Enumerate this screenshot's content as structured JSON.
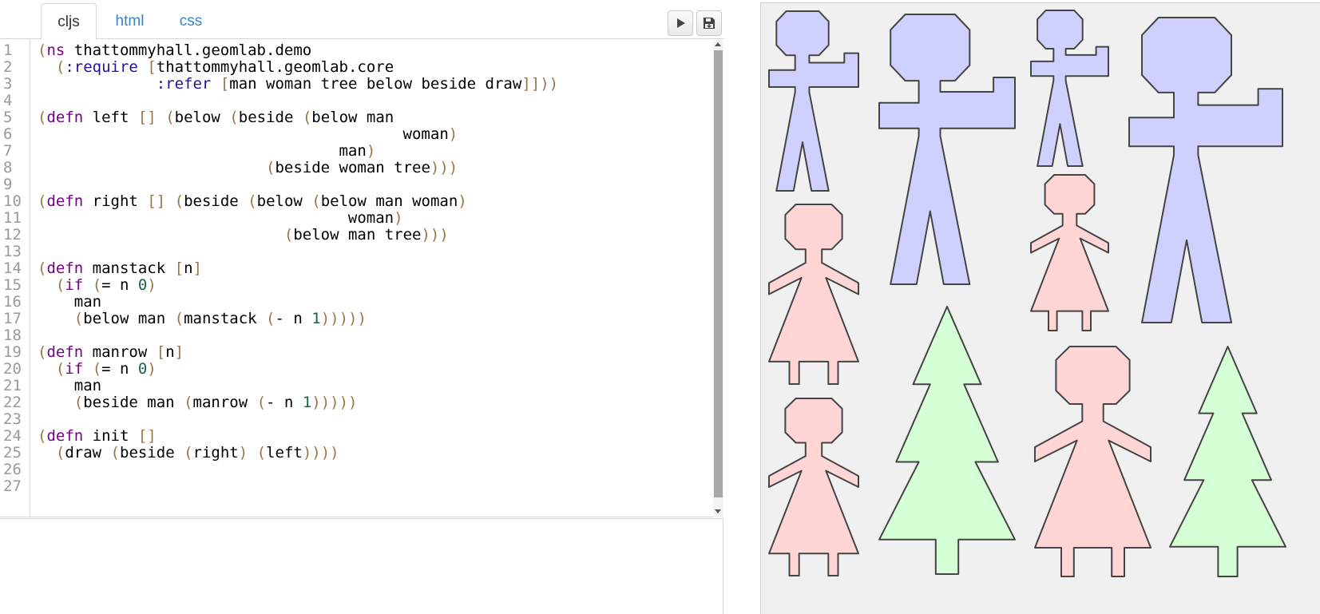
{
  "tabs": [
    {
      "label": "cljs",
      "active": true
    },
    {
      "label": "html",
      "active": false
    },
    {
      "label": "css",
      "active": false
    }
  ],
  "toolbar": {
    "run_icon": "play-icon",
    "save_icon": "save-icon"
  },
  "editor": {
    "line_numbers": [
      "1",
      "2",
      "3",
      "4",
      "5",
      "6",
      "7",
      "8",
      "9",
      "10",
      "11",
      "12",
      "13",
      "14",
      "15",
      "16",
      "17",
      "18",
      "19",
      "20",
      "21",
      "22",
      "23",
      "24",
      "25",
      "26",
      "27"
    ],
    "lines": [
      [
        [
          "br",
          "("
        ],
        [
          "kw",
          "ns"
        ],
        [
          "t",
          " thattommyhall.geomlab.demo"
        ]
      ],
      [
        [
          "t",
          "  "
        ],
        [
          "br",
          "("
        ],
        [
          "atom",
          ":require"
        ],
        [
          "t",
          " "
        ],
        [
          "br",
          "["
        ],
        [
          "t",
          "thattommyhall.geomlab.core"
        ]
      ],
      [
        [
          "t",
          "             "
        ],
        [
          "atom",
          ":refer"
        ],
        [
          "t",
          " "
        ],
        [
          "br",
          "["
        ],
        [
          "t",
          "man woman tree below beside draw"
        ],
        [
          "br",
          "]]))"
        ]
      ],
      [],
      [
        [
          "br",
          "("
        ],
        [
          "kw",
          "defn"
        ],
        [
          "t",
          " left "
        ],
        [
          "br",
          "[]"
        ],
        [
          "t",
          " "
        ],
        [
          "br",
          "("
        ],
        [
          "t",
          "below "
        ],
        [
          "br",
          "("
        ],
        [
          "t",
          "beside "
        ],
        [
          "br",
          "("
        ],
        [
          "t",
          "below man"
        ]
      ],
      [
        [
          "t",
          "                                        woman"
        ],
        [
          "br",
          ")"
        ]
      ],
      [
        [
          "t",
          "                                 man"
        ],
        [
          "br",
          ")"
        ]
      ],
      [
        [
          "t",
          "                         "
        ],
        [
          "br",
          "("
        ],
        [
          "t",
          "beside woman tree"
        ],
        [
          "br",
          ")))"
        ]
      ],
      [],
      [
        [
          "br",
          "("
        ],
        [
          "kw",
          "defn"
        ],
        [
          "t",
          " right "
        ],
        [
          "br",
          "[]"
        ],
        [
          "t",
          " "
        ],
        [
          "br",
          "("
        ],
        [
          "t",
          "beside "
        ],
        [
          "br",
          "("
        ],
        [
          "t",
          "below "
        ],
        [
          "br",
          "("
        ],
        [
          "t",
          "below man woman"
        ],
        [
          "br",
          ")"
        ]
      ],
      [
        [
          "t",
          "                                  woman"
        ],
        [
          "br",
          ")"
        ]
      ],
      [
        [
          "t",
          "                           "
        ],
        [
          "br",
          "("
        ],
        [
          "t",
          "below man tree"
        ],
        [
          "br",
          ")))"
        ]
      ],
      [],
      [
        [
          "br",
          "("
        ],
        [
          "kw",
          "defn"
        ],
        [
          "t",
          " manstack "
        ],
        [
          "br",
          "["
        ],
        [
          "t",
          "n"
        ],
        [
          "br",
          "]"
        ]
      ],
      [
        [
          "t",
          "  "
        ],
        [
          "br",
          "("
        ],
        [
          "kw",
          "if"
        ],
        [
          "t",
          " "
        ],
        [
          "br",
          "("
        ],
        [
          "t",
          "= n "
        ],
        [
          "num",
          "0"
        ],
        [
          "br",
          ")"
        ]
      ],
      [
        [
          "t",
          "    man"
        ]
      ],
      [
        [
          "t",
          "    "
        ],
        [
          "br",
          "("
        ],
        [
          "t",
          "below man "
        ],
        [
          "br",
          "("
        ],
        [
          "t",
          "manstack "
        ],
        [
          "br",
          "("
        ],
        [
          "t",
          "- n "
        ],
        [
          "num",
          "1"
        ],
        [
          "br",
          ")))))"
        ]
      ],
      [],
      [
        [
          "br",
          "("
        ],
        [
          "kw",
          "defn"
        ],
        [
          "t",
          " manrow "
        ],
        [
          "br",
          "["
        ],
        [
          "t",
          "n"
        ],
        [
          "br",
          "]"
        ]
      ],
      [
        [
          "t",
          "  "
        ],
        [
          "br",
          "("
        ],
        [
          "kw",
          "if"
        ],
        [
          "t",
          " "
        ],
        [
          "br",
          "("
        ],
        [
          "t",
          "= n "
        ],
        [
          "num",
          "0"
        ],
        [
          "br",
          ")"
        ]
      ],
      [
        [
          "t",
          "    man"
        ]
      ],
      [
        [
          "t",
          "    "
        ],
        [
          "br",
          "("
        ],
        [
          "t",
          "beside man "
        ],
        [
          "br",
          "("
        ],
        [
          "t",
          "manrow "
        ],
        [
          "br",
          "("
        ],
        [
          "t",
          "- n "
        ],
        [
          "num",
          "1"
        ],
        [
          "br",
          ")))))"
        ]
      ],
      [],
      [
        [
          "br",
          "("
        ],
        [
          "kw",
          "defn"
        ],
        [
          "t",
          " init "
        ],
        [
          "br",
          "[]"
        ]
      ],
      [
        [
          "t",
          "  "
        ],
        [
          "br",
          "("
        ],
        [
          "t",
          "draw "
        ],
        [
          "br",
          "("
        ],
        [
          "t",
          "beside "
        ],
        [
          "br",
          "("
        ],
        [
          "t",
          "right"
        ],
        [
          "br",
          ")"
        ],
        [
          "t",
          " "
        ],
        [
          "br",
          "("
        ],
        [
          "t",
          "left"
        ],
        [
          "br",
          "))))"
        ]
      ],
      [],
      []
    ]
  },
  "console": {
    "text": ""
  },
  "drawing": {
    "colors": {
      "man": "#d0d0ff",
      "woman": "#ffd5d5",
      "tree": "#d5ffd5",
      "outline": "#444444",
      "background": "#f0f0f0"
    },
    "figures": [
      {
        "kind": "man",
        "name": "man-figure"
      },
      {
        "kind": "woman",
        "name": "woman-figure"
      },
      {
        "kind": "woman",
        "name": "woman-figure"
      },
      {
        "kind": "man",
        "name": "man-figure"
      },
      {
        "kind": "tree",
        "name": "tree-figure"
      },
      {
        "kind": "man",
        "name": "man-figure"
      },
      {
        "kind": "woman",
        "name": "woman-figure"
      },
      {
        "kind": "woman",
        "name": "woman-figure"
      },
      {
        "kind": "man",
        "name": "man-figure"
      },
      {
        "kind": "tree",
        "name": "tree-figure"
      }
    ]
  }
}
